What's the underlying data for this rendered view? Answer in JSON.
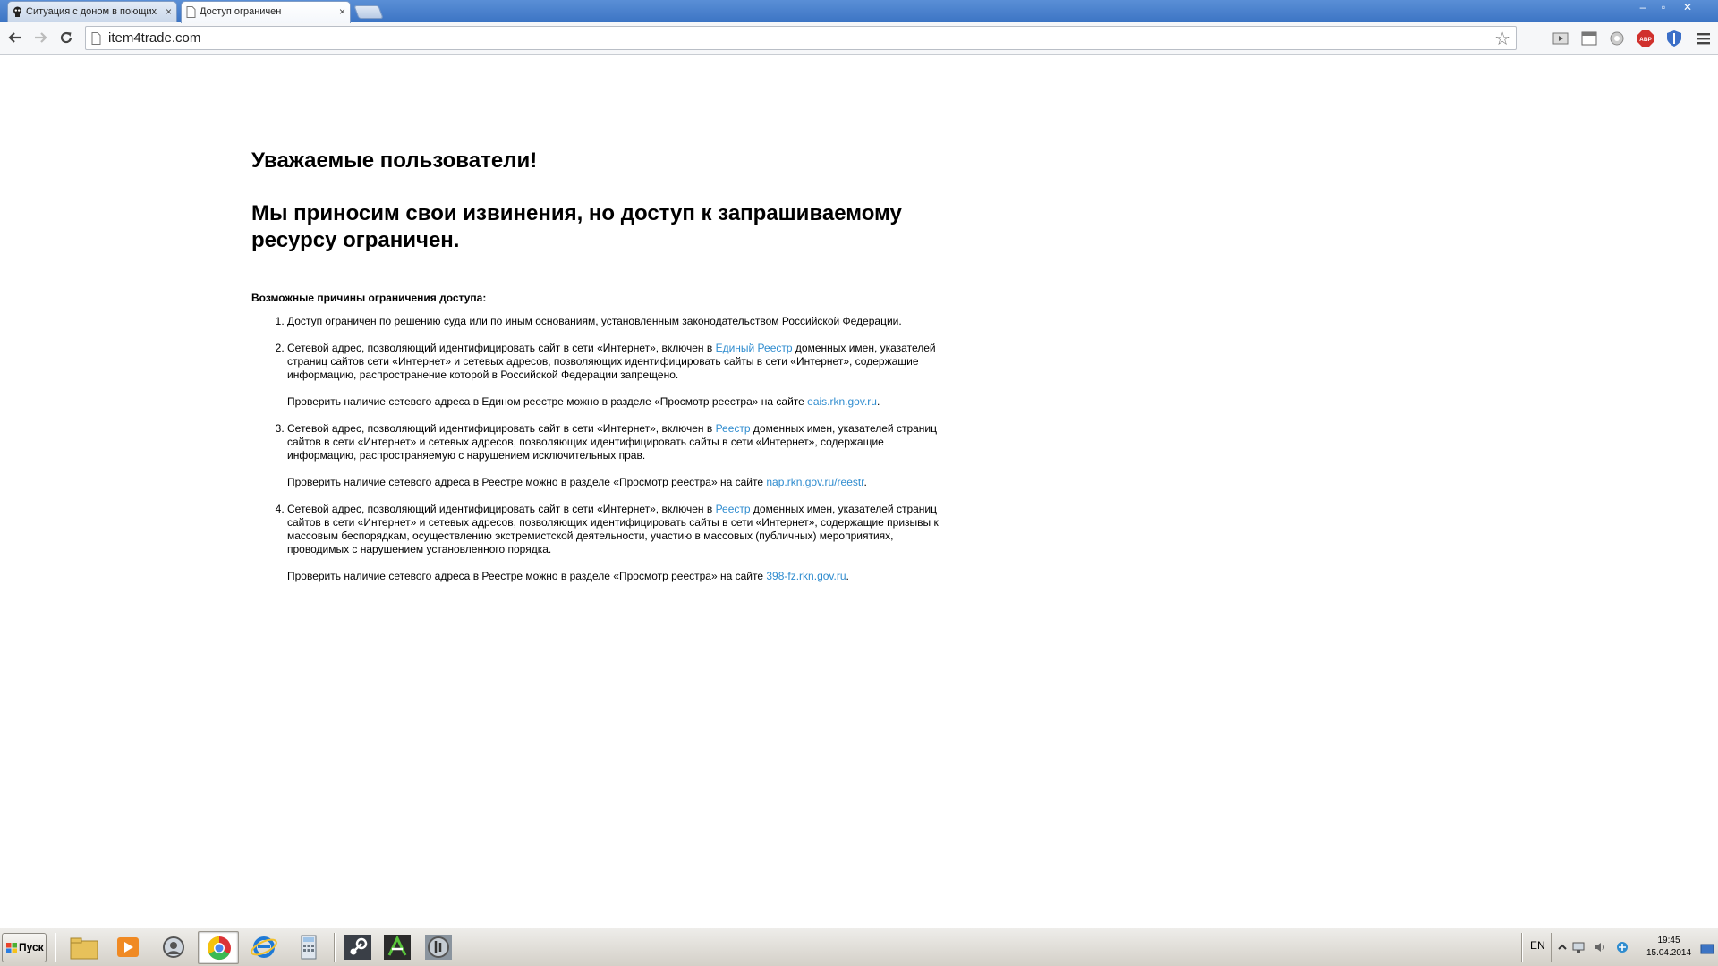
{
  "browser": {
    "tabs": [
      {
        "title": "Ситуация с доном в поющих",
        "close_label": "×",
        "active": false
      },
      {
        "title": "Доступ ограничен",
        "close_label": "×",
        "active": true
      }
    ],
    "window_controls": {
      "minimize": "–",
      "restore": "▫",
      "close": "✕"
    },
    "url": "item4trade.com",
    "extensions": [
      "video-icon",
      "window-icon",
      "ghostery-icon",
      "adblock-plus-icon",
      "shield-icon",
      "menu-icon"
    ],
    "adblock_label": "ABP"
  },
  "page": {
    "heading1": "Уважаемые пользователи!",
    "heading2": "Мы приносим свои извинения, но доступ к запрашиваемому ресурсу ограничен.",
    "causes_title": "Возможные причины ограничения доступа:",
    "causes": [
      {
        "text": "Доступ ограничен  по решению суда или по иным основаниям, установленным законодательством Российской Федерации."
      },
      {
        "text_before": "Сетевой адрес, позволяющий идентифицировать сайт в сети «Интернет», включен в ",
        "link": "Единый Реестр",
        "text_after": " доменных имен, указателей страниц сайтов сети «Интернет» и сетевых адресов, позволяющих идентифицировать сайты в сети «Интернет», содержащие информацию, распространение которой в Российской Федерации запрещено.",
        "check_before": "Проверить наличие сетевого адреса в Едином реестре можно в разделе «Просмотр реестра» на сайте ",
        "check_link": "eais.rkn.gov.ru",
        "check_after": "."
      },
      {
        "text_before": "Сетевой адрес, позволяющий идентифицировать сайт в сети «Интернет», включен в ",
        "link": "Реестр",
        "text_after": " доменных имен, указателей страниц сайтов в сети «Интернет» и сетевых адресов, позволяющих идентифицировать сайты в сети «Интернет», содержащие информацию, распространяемую с нарушением исключительных прав.",
        "check_before": "Проверить наличие сетевого адреса в Реестре можно в разделе «Просмотр реестра» на сайте ",
        "check_link": "nap.rkn.gov.ru/reestr",
        "check_after": "."
      },
      {
        "text_before": "Сетевой адрес, позволяющий идентифицировать сайт в сети «Интернет», включен в ",
        "link": "Реестр",
        "text_after": " доменных имен, указателей страниц сайтов в сети «Интернет» и сетевых адресов, позволяющих идентифицировать сайты в сети «Интернет», содержащие призывы к массовым беспорядкам, осуществлению экстремистской деятельности, участию в массовых (публичных) мероприятиях, проводимых с нарушением установленного порядка.",
        "check_before": "Проверить наличие сетевого адреса в Реестре можно в разделе «Просмотр реестра» на сайте ",
        "check_link": "398-fz.rkn.gov.ru",
        "check_after": "."
      }
    ],
    "link_color": "#2f8ccf"
  },
  "taskbar": {
    "start_label": "Пуск",
    "apps": [
      "file-manager-icon",
      "media-player-icon",
      "chat-client-icon",
      "chrome-icon",
      "internet-explorer-icon",
      "calculator-icon",
      "steam-icon",
      "terminal-app-icon",
      "audio-app-icon"
    ],
    "language": "EN",
    "clock_time": "19:45",
    "clock_date": "15.04.2014"
  }
}
